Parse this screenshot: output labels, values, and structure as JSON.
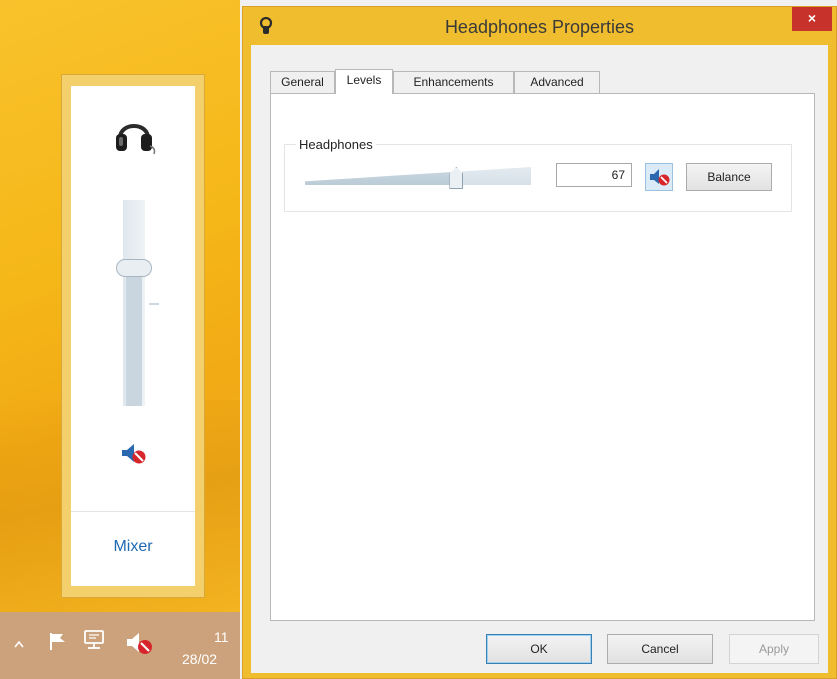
{
  "flyout": {
    "volume_percent": 67,
    "mixer_label": "Mixer",
    "icons": [
      "headphones-icon",
      "speaker-muted-icon"
    ]
  },
  "taskbar": {
    "icons": [
      "show-hidden-icons-chevron",
      "action-center-flag-icon",
      "network-icon",
      "speaker-muted-icon"
    ],
    "clock_time": "11",
    "clock_date": "28/02"
  },
  "dialog": {
    "title": "Headphones Properties",
    "close_label": "×",
    "tabs": [
      {
        "label": "General",
        "active": false
      },
      {
        "label": "Levels",
        "active": true
      },
      {
        "label": "Enhancements",
        "active": false
      },
      {
        "label": "Advanced",
        "active": false
      }
    ],
    "levels": {
      "group_label": "Headphones",
      "value": "67",
      "value_max": 100,
      "balance_label": "Balance",
      "muted": true
    },
    "buttons": {
      "ok": "OK",
      "cancel": "Cancel",
      "apply": "Apply"
    }
  },
  "colors": {
    "desktop_accent": "#f5b718",
    "close_red": "#c7322b",
    "link_blue": "#1f69b3",
    "mute_red": "#d6262b"
  }
}
